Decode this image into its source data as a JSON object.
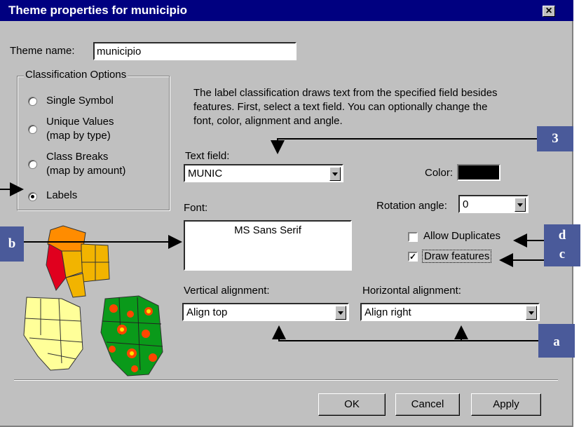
{
  "dialog": {
    "title": "Theme properties for municipio",
    "close_glyph": "×",
    "theme_name_label": "Theme name:",
    "theme_name_value": "municipio"
  },
  "classification": {
    "group_label": "Classification Options",
    "options": [
      {
        "label_lines": [
          "Single Symbol"
        ],
        "selected": false
      },
      {
        "label_lines": [
          "Unique Values",
          "(map by type)"
        ],
        "selected": false
      },
      {
        "label_lines": [
          "Class Breaks",
          "(map by amount)"
        ],
        "selected": false
      },
      {
        "label_lines": [
          "Labels"
        ],
        "selected": true
      }
    ]
  },
  "description": {
    "line1": "The label classification draws text from the specified field besides",
    "line2": "features. First, select a text field. You can optionally change the",
    "line3": "font, color, alignment and angle."
  },
  "text_field": {
    "label": "Text field:",
    "value": "MUNIC"
  },
  "color": {
    "label": "Color:",
    "swatch": "#000000"
  },
  "rotation": {
    "label": "Rotation angle:",
    "value": "0"
  },
  "font": {
    "label": "Font:",
    "value": "MS Sans Serif"
  },
  "options": {
    "allow_duplicates": {
      "label": "Allow Duplicates",
      "checked": false
    },
    "draw_features": {
      "label": "Draw features",
      "checked": true,
      "check_glyph": "✓"
    }
  },
  "vertical_alignment": {
    "label": "Vertical alignment:",
    "value": "Align top"
  },
  "horizontal_alignment": {
    "label": "Horizontal alignment:",
    "value": "Align right"
  },
  "buttons": {
    "ok": "OK",
    "cancel": "Cancel",
    "apply": "Apply"
  },
  "callouts": {
    "n3": "3",
    "b": "b",
    "d": "d",
    "c": "c",
    "a": "a"
  },
  "colors": {
    "titlebar": "#000080",
    "dialog": "#c0c0c0",
    "callout": "#4a5a9a"
  },
  "map_previews": [
    "map-preview-graduated",
    "map-preview-unique",
    "map-preview-labels"
  ]
}
